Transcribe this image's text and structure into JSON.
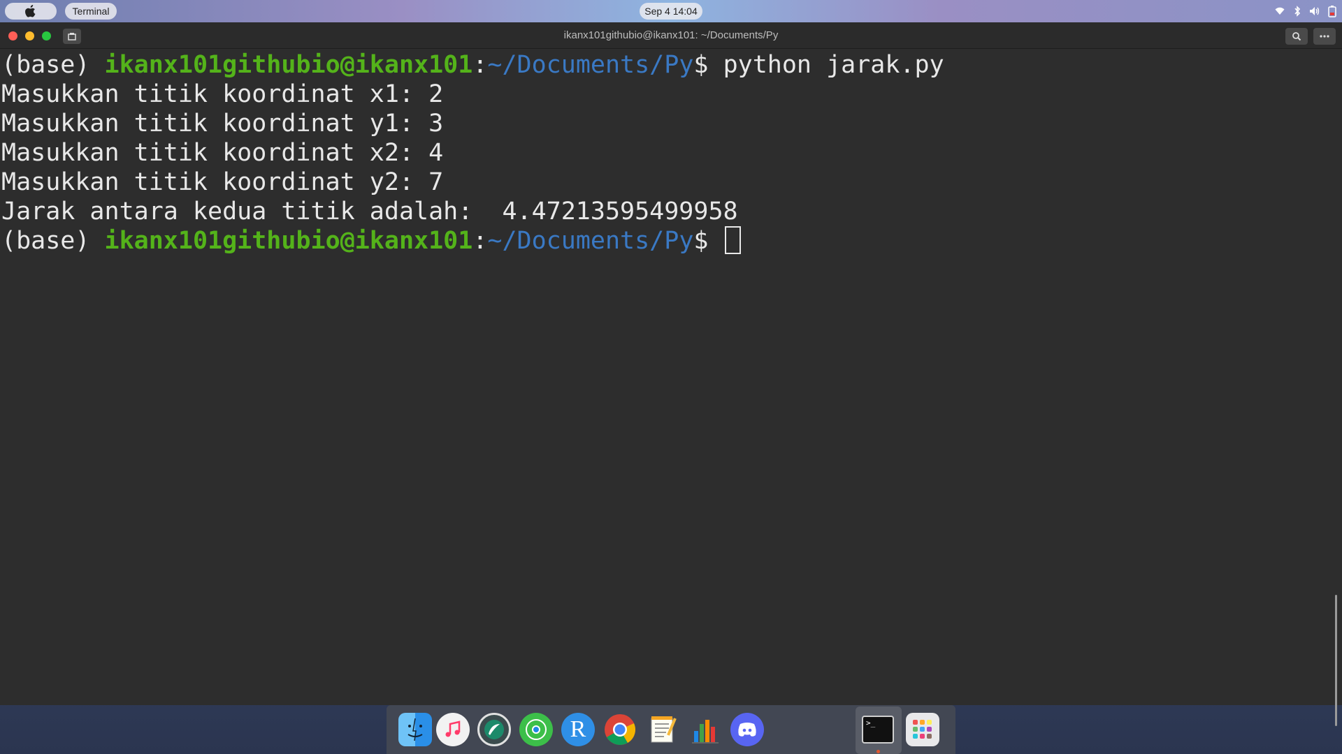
{
  "topbar": {
    "app_name": "Terminal",
    "clock": "Sep 4  14:04",
    "tray_icons": [
      "wifi-icon",
      "bluetooth-icon",
      "volume-icon",
      "battery-icon"
    ]
  },
  "window": {
    "title": "ikanx101githubio@ikanx101: ~/Documents/Py"
  },
  "terminal": {
    "prompt": {
      "env": "(base) ",
      "user": "ikanx101githubio@ikanx101",
      "colon": ":",
      "path": "~/Documents/Py",
      "dollar": "$ "
    },
    "command": "python jarak.py",
    "output": [
      "Masukkan titik koordinat x1: 2",
      "Masukkan titik koordinat y1: 3",
      "Masukkan titik koordinat x2: 4",
      "Masukkan titik koordinat y2: 7",
      "Jarak antara kedua titik adalah:  4.47213595499958"
    ]
  },
  "dock": {
    "items": [
      "finder-icon",
      "music-icon",
      "rstudio-icon",
      "maps-icon",
      "r-icon",
      "chrome-icon",
      "textedit-icon",
      "numbers-icon",
      "discord-icon",
      "terminal-icon",
      "launchpad-icon"
    ],
    "r_letter": "R",
    "terminal_glyph": ">_"
  },
  "colors": {
    "user": "#54b31a",
    "path": "#3a79c4",
    "background": "#2d2d2d"
  }
}
